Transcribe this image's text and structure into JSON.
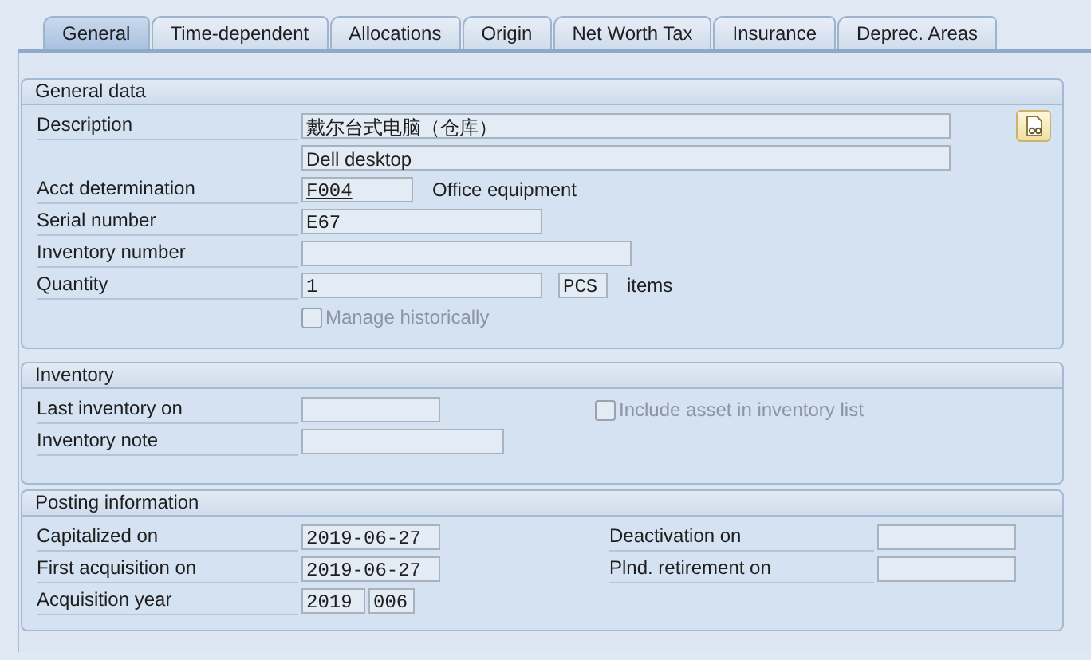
{
  "tabs": [
    {
      "label": "General",
      "selected": true
    },
    {
      "label": "Time-dependent",
      "selected": false
    },
    {
      "label": "Allocations",
      "selected": false
    },
    {
      "label": "Origin",
      "selected": false
    },
    {
      "label": "Net Worth Tax",
      "selected": false
    },
    {
      "label": "Insurance",
      "selected": false
    },
    {
      "label": "Deprec. Areas",
      "selected": false
    }
  ],
  "general_data": {
    "title": "General data",
    "description": {
      "label": "Description",
      "value": "戴尔台式电脑（仓库）",
      "value_2": "Dell desktop"
    },
    "acct_determination": {
      "label": "Acct determination",
      "value": "F004",
      "text": "Office equipment"
    },
    "serial_number": {
      "label": "Serial number",
      "value": "E67"
    },
    "inventory_number": {
      "label": "Inventory number"
    },
    "quantity": {
      "label": "Quantity",
      "value": "1",
      "unit": "PCS",
      "unit_text": "items"
    },
    "manage_historically": {
      "label": "Manage historically",
      "checked": false,
      "disabled": true
    }
  },
  "inventory": {
    "title": "Inventory",
    "last_inventory_on": {
      "label": "Last inventory on"
    },
    "include_in_inventory_list": {
      "label": "Include asset in inventory list",
      "checked": false,
      "disabled": true
    },
    "inventory_note": {
      "label": "Inventory note"
    }
  },
  "posting_information": {
    "title": "Posting information",
    "capitalized_on": {
      "label": "Capitalized on",
      "value": "2019-06-27"
    },
    "first_acquisition_on": {
      "label": "First acquisition on",
      "value": "2019-06-27"
    },
    "acquisition_year": {
      "label": "Acquisition year",
      "value": "2019",
      "period": "006"
    },
    "deactivation_on": {
      "label": "Deactivation on"
    },
    "plnd_retirement_on": {
      "label": "Plnd. retirement on"
    }
  }
}
